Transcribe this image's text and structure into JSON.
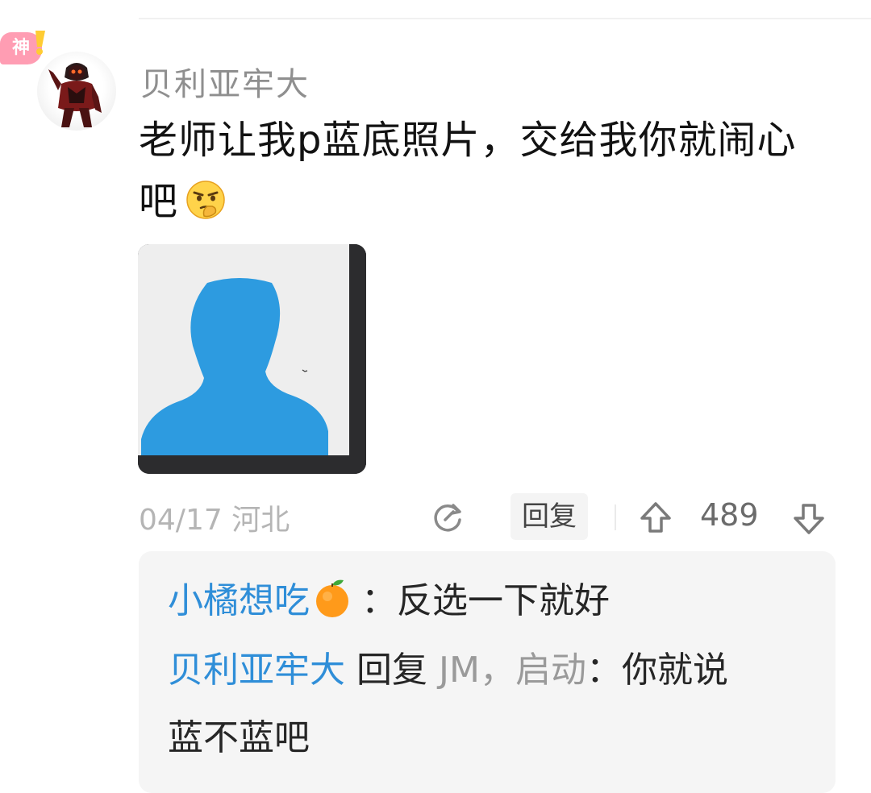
{
  "comment": {
    "badge": "神",
    "username": "贝利亚牢大",
    "text_line1": "老师让我p蓝底照片，交给我你就闹心",
    "text_line2": "吧",
    "emoji": "thinking-face-emoji",
    "meta": {
      "date": "04/17",
      "location": "河北"
    },
    "reply_label": "回复",
    "vote_count": "489"
  },
  "replies": [
    {
      "author": "小橘想吃",
      "emoji": "tangerine-emoji",
      "separator": "：",
      "text": "反选一下就好"
    },
    {
      "author": "贝利亚牢大",
      "reply_word": "回复",
      "reply_to": "JM，启动",
      "separator": "：",
      "text_line1": "你就说",
      "text_line2": "蓝不蓝吧"
    }
  ],
  "colors": {
    "link_blue": "#2f8ed8",
    "muted": "#8f8f8f",
    "silhouette": "#2d9be0"
  },
  "icons": [
    "shen-badge",
    "share-icon",
    "upvote-icon",
    "downvote-icon"
  ]
}
